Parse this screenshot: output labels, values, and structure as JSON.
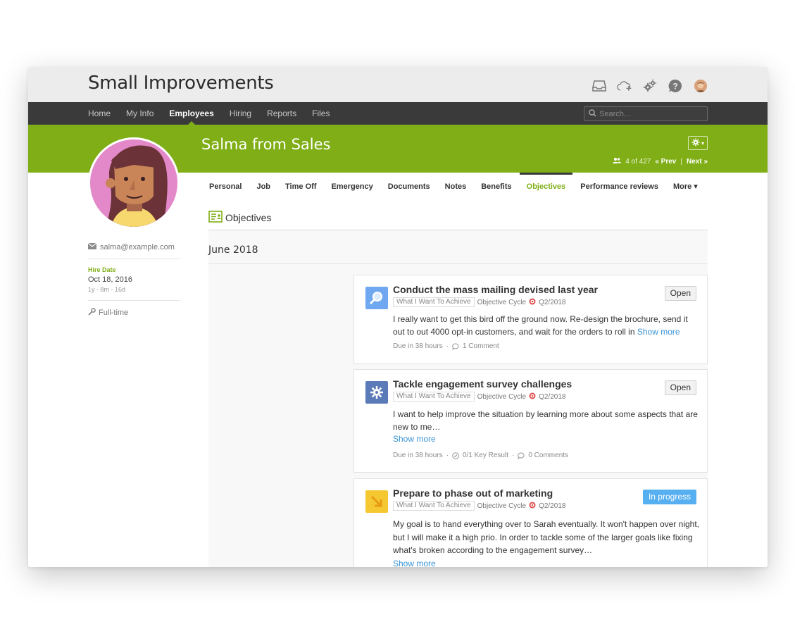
{
  "app": {
    "title": "Small Improvements"
  },
  "nav": {
    "items": [
      {
        "label": "Home",
        "active": false
      },
      {
        "label": "My Info",
        "active": false
      },
      {
        "label": "Employees",
        "active": true
      },
      {
        "label": "Hiring",
        "active": false
      },
      {
        "label": "Reports",
        "active": false
      },
      {
        "label": "Files",
        "active": false
      }
    ],
    "search_placeholder": "Search..."
  },
  "header_icons": [
    "inbox-icon",
    "cloud-upload-icon",
    "gears-icon",
    "help-icon",
    "user-avatar"
  ],
  "profile": {
    "name": "Salma from Sales",
    "pager": {
      "position": "4 of 427",
      "prev": "« Prev",
      "separator": "|",
      "next": "Next »"
    },
    "email": "salma@example.com",
    "hire_label": "Hire Date",
    "hire_date": "Oct 18, 2016",
    "hire_duration": "1y - 8m - 16d",
    "employment_type": "Full-time"
  },
  "tabs": [
    {
      "label": "Personal"
    },
    {
      "label": "Job"
    },
    {
      "label": "Time Off"
    },
    {
      "label": "Emergency"
    },
    {
      "label": "Documents"
    },
    {
      "label": "Notes"
    },
    {
      "label": "Benefits"
    },
    {
      "label": "Objectives",
      "active": true
    },
    {
      "label": "Performance reviews"
    },
    {
      "label": "More ▾"
    }
  ],
  "section": {
    "title": "Objectives",
    "month": "June 2018"
  },
  "objectives": [
    {
      "title": "Conduct the mass mailing devised last year",
      "tag": "What I Want To Achieve",
      "cycle": "Objective Cycle",
      "period": "Q2/2018",
      "status": "Open",
      "body": "I really want to get this bird off the ground now. Re-design the brochure, send it out to out 4000 opt-in customers, and wait for the orders to roll in",
      "show_more": "Show more",
      "due": "Due in 38 hours",
      "comments": "1 Comment",
      "icon": "search-icon",
      "icon_color": "#6fa8f0"
    },
    {
      "title": "Tackle engagement survey challenges",
      "tag": "What I Want To Achieve",
      "cycle": "Objective Cycle",
      "period": "Q2/2018",
      "status": "Open",
      "body": "I want to help improve the situation by learning more about some aspects that are new to me…",
      "show_more": "Show more",
      "due": "Due in 38 hours",
      "key_results": "0/1 Key Result",
      "comments": "0 Comments",
      "icon": "gear-icon",
      "icon_color": "#5b7ab8"
    },
    {
      "title": "Prepare to phase out of marketing",
      "tag": "What I Want To Achieve",
      "cycle": "Objective Cycle",
      "period": "Q2/2018",
      "status": "In progress",
      "body": "My goal is to hand everything over to Sarah eventually. It won't happen over night, but I will make it a high prio. In order to tackle some of the larger goals like fixing what's broken according to the engagement survey…",
      "show_more": "Show more",
      "icon": "arrow-down-right-icon",
      "icon_color": "#f5c832"
    }
  ],
  "colors": {
    "brand_green": "#7fae16",
    "nav_dark": "#3a3a3a",
    "link_blue": "#3a93d4",
    "progress_blue": "#56aff0"
  }
}
